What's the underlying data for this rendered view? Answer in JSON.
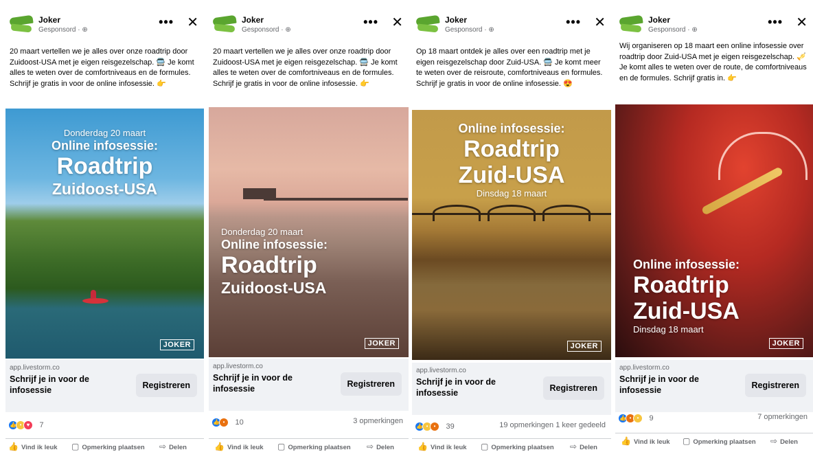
{
  "posts": [
    {
      "page_name": "Joker",
      "sponsored": "Gesponsord · ⊕",
      "body": "20 maart vertellen we je alles over onze roadtrip door Zuidoost-USA met je eigen reisgezelschap. 🚍 Je komt alles te weten over de comfortniveaus en de formules. Schrijf je gratis in voor de online infosessie. 👉",
      "overlay": {
        "date": "Donderdag 20 maart",
        "sub": "Online infosessie:",
        "big": "Roadtrip",
        "place": "Zuidoost-USA"
      },
      "brand": "JOKER",
      "domain": "app.livestorm.co",
      "headline": "Schrijf je in voor de infosessie",
      "cta": "Registreren",
      "reaction_icons": [
        "like",
        "haha",
        "love"
      ],
      "reaction_count": "7",
      "comments": "",
      "actions": {
        "like": "Vind ik leuk",
        "comment": "Opmerking plaatsen",
        "share": "Delen"
      }
    },
    {
      "page_name": "Joker",
      "sponsored": "Gesponsord · ⊕",
      "body": "20 maart vertellen we je alles over onze roadtrip door Zuidoost-USA met je eigen reisgezelschap. 🚍 Je komt alles te weten over de comfortniveaus en de formules. Schrijf je gratis in voor de online infosessie. 👉",
      "overlay": {
        "date": "Donderdag 20 maart",
        "sub": "Online infosessie:",
        "big": "Roadtrip",
        "place": "Zuidoost-USA"
      },
      "brand": "JOKER",
      "domain": "app.livestorm.co",
      "headline": "Schrijf je in voor de infosessie",
      "cta": "Registreren",
      "reaction_icons": [
        "like",
        "angry"
      ],
      "reaction_count": "10",
      "comments": "3 opmerkingen",
      "actions": {
        "like": "Vind ik leuk",
        "comment": "Opmerking plaatsen",
        "share": "Delen"
      }
    },
    {
      "page_name": "Joker",
      "sponsored": "Gesponsord · ⊕",
      "body": "Op 18 maart ontdek je alles over een roadtrip met je eigen reisgezelschap door Zuid-USA. 🚍 Je komt meer te weten over de reisroute, comfortniveaus en formules. Schrijf je gratis in voor de online infosessie. 😍",
      "overlay": {
        "date": "Dinsdag 18 maart",
        "sub": "Online infosessie:",
        "big": "Roadtrip",
        "place": "Zuid-USA"
      },
      "brand": "JOKER",
      "domain": "app.livestorm.co",
      "headline": "Schrijf je in voor de infosessie",
      "cta": "Registreren",
      "reaction_icons": [
        "like",
        "haha",
        "angry"
      ],
      "reaction_count": "39",
      "comments": "19 opmerkingen   1 keer gedeeld",
      "actions": {
        "like": "Vind ik leuk",
        "comment": "Opmerking plaatsen",
        "share": "Delen"
      }
    },
    {
      "page_name": "Joker",
      "sponsored": "Gesponsord · ⊕",
      "body": "Wij organiseren op 18 maart een online infosessie over roadtrip door Zuid-USA met je eigen reisgezelschap. 🎺 Je komt alles te weten over de route, de comfortniveaus en de formules. Schrijf gratis in. 👉",
      "overlay": {
        "date": "Dinsdag 18 maart",
        "sub": "Online infosessie:",
        "big": "Roadtrip",
        "place": "Zuid-USA"
      },
      "brand": "JOKER",
      "domain": "app.livestorm.co",
      "headline": "Schrijf je in voor de infosessie",
      "cta": "Registreren",
      "reaction_icons": [
        "like",
        "angry",
        "haha"
      ],
      "reaction_count": "9",
      "comments": "7 opmerkingen",
      "actions": {
        "like": "Vind ik leuk",
        "comment": "Opmerking plaatsen",
        "share": "Delen"
      }
    }
  ],
  "icons": {
    "more": "more-horizontal-icon",
    "close": "close-icon",
    "like": "thumbs-up-icon",
    "comment": "comment-bubble-icon",
    "share": "share-arrow-icon"
  },
  "colors": {
    "facebook_blue": "#1877f2",
    "cta_bg": "#e4e6eb",
    "muted_text": "#65676b",
    "brand_green": "#5aa52f"
  }
}
